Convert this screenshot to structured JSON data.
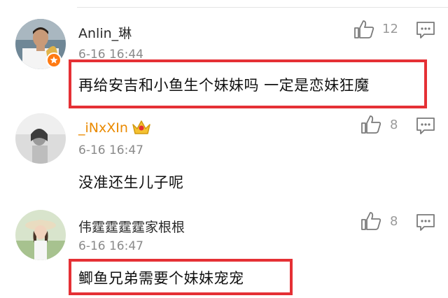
{
  "comments": [
    {
      "username": "Anlin_琳",
      "timestamp": "6-16 16:44",
      "text": "再给安吉和小鱼生个妹妹吗 一定是恋妹狂魔",
      "likes": "12",
      "avatar_icon": "footballer-avatar",
      "badge_icon": "verified-star-icon",
      "highlighted": true
    },
    {
      "username": "_iNxXIn",
      "timestamp": "6-16 16:47",
      "text": "没准还生儿子呢",
      "likes": "8",
      "avatar_icon": "girl-avatar",
      "badge_icon": "crown-icon",
      "highlighted": false
    },
    {
      "username": "伟霆霆霆霆家根根",
      "timestamp": "6-16 16:47",
      "text": "鲫鱼兄弟需要个妹妹宠宠",
      "likes": "8",
      "avatar_icon": "girl-hat-avatar",
      "highlighted": true
    }
  ],
  "colors": {
    "highlight_border": "#e53035",
    "username": "#2b2b2b",
    "username_vip": "#ea8a00",
    "timestamp": "#8a8a8a",
    "badge": "#ff7a12"
  }
}
